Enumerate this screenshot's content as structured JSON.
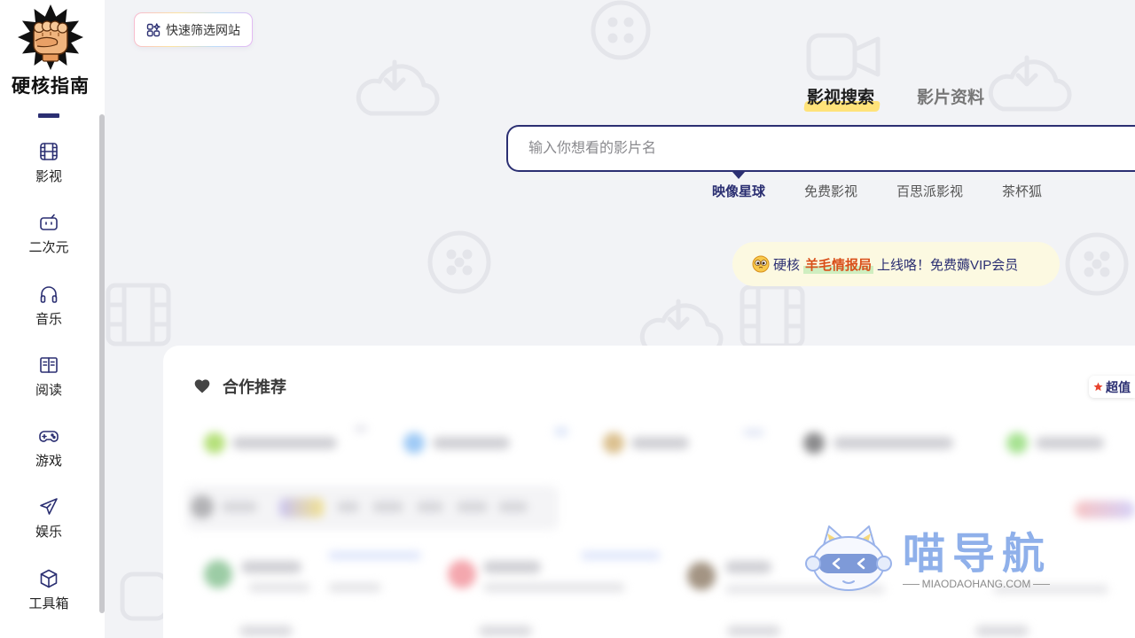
{
  "brand": {
    "name": "硬核指南",
    "logo_icon": "fist-logo-icon"
  },
  "quick_filter": {
    "label": "快速筛选网站",
    "icon": "grid-sparkle-icon"
  },
  "sidebar": {
    "items": [
      {
        "label": "影视",
        "icon": "film-icon",
        "active": true
      },
      {
        "label": "二次元",
        "icon": "tv-icon"
      },
      {
        "label": "音乐",
        "icon": "headphones-icon"
      },
      {
        "label": "阅读",
        "icon": "book-icon"
      },
      {
        "label": "游戏",
        "icon": "gamepad-icon"
      },
      {
        "label": "娱乐",
        "icon": "paper-plane-icon"
      },
      {
        "label": "工具箱",
        "icon": "box-icon"
      }
    ]
  },
  "search": {
    "tabs": [
      {
        "label": "影视搜索",
        "active": true
      },
      {
        "label": "影片资料",
        "active": false
      }
    ],
    "placeholder": "输入你想看的影片名",
    "sources": [
      {
        "label": "映像星球",
        "active": true
      },
      {
        "label": "免费影视",
        "active": false
      },
      {
        "label": "百思派影视",
        "active": false
      },
      {
        "label": "茶杯狐",
        "active": false
      }
    ]
  },
  "announcement": {
    "icon": "pleading-face-icon",
    "prefix": "硬核",
    "highlight": "羊毛情报局",
    "suffix": "上线咯！免费薅VIP会员"
  },
  "recommend": {
    "title": "合作推荐",
    "icon": "heart-icon",
    "tag": {
      "label": "超值",
      "icon": "star-icon"
    }
  },
  "watermark": {
    "name": "喵导航",
    "domain": "MIAODAOHANG.COM"
  },
  "colors": {
    "primary": "#2b2f72",
    "tab_highlight": "#ffe37a",
    "announcement_bg": "#fcf9e1",
    "announcement_highlight": "#d9501a",
    "page_bg": "#f2f3f6"
  }
}
